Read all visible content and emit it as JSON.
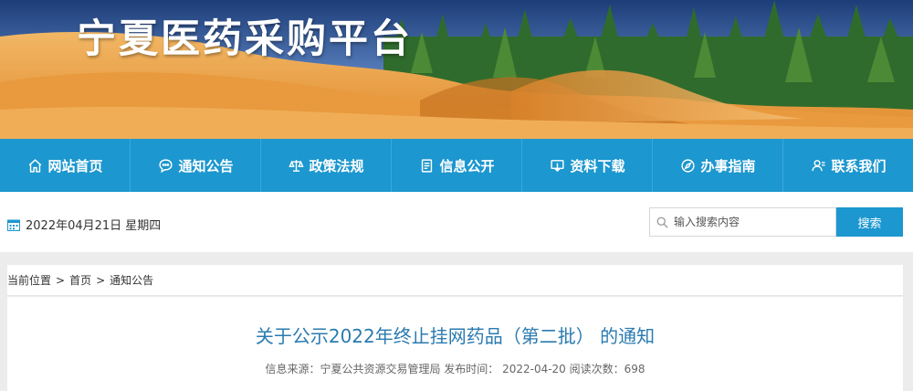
{
  "site": {
    "title": "宁夏医药采购平台"
  },
  "nav": {
    "items": [
      {
        "label": "网站首页",
        "icon": "home-icon"
      },
      {
        "label": "通知公告",
        "icon": "chat-icon"
      },
      {
        "label": "政策法规",
        "icon": "scale-icon"
      },
      {
        "label": "信息公开",
        "icon": "document-icon"
      },
      {
        "label": "资料下载",
        "icon": "download-icon"
      },
      {
        "label": "办事指南",
        "icon": "compass-icon"
      },
      {
        "label": "联系我们",
        "icon": "contact-icon"
      }
    ]
  },
  "infobar": {
    "date": "2022年04月21日 星期四",
    "search_placeholder": "输入搜索内容",
    "search_button": "搜索"
  },
  "breadcrumb": {
    "prefix": "当前位置",
    "sep": ">",
    "items": [
      "首页",
      "通知公告"
    ]
  },
  "article": {
    "title": "关于公示2022年终止挂网药品（第二批） 的通知",
    "meta": "信息来源：宁夏公共资源交易管理局 发布时间： 2022-04-20 阅读次数：698"
  },
  "colors": {
    "accent": "#1c97cf",
    "title": "#2a7bb0"
  }
}
